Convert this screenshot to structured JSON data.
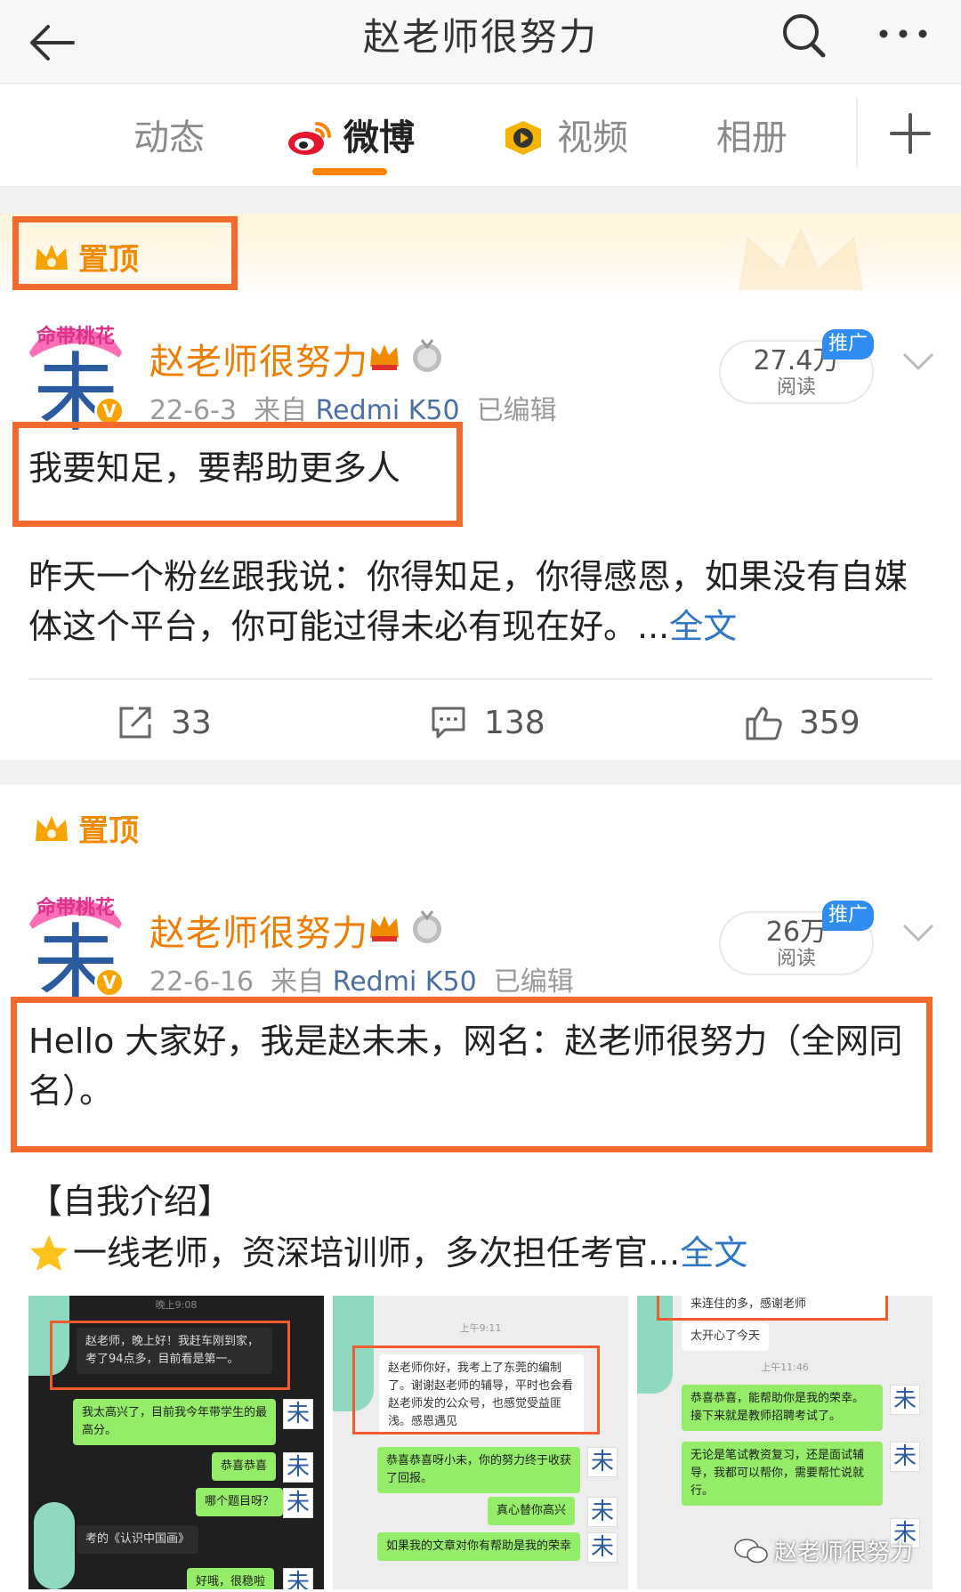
{
  "header": {
    "title": "赵老师很努力",
    "back_icon": "back-arrow-icon",
    "search_icon": "search-icon",
    "more_icon": "more-dots-icon"
  },
  "tabs": [
    {
      "label": "动态",
      "active": false
    },
    {
      "label": "微博",
      "active": true,
      "icon": "weibo-logo-icon"
    },
    {
      "label": "视频",
      "active": false,
      "icon": "video-play-icon"
    },
    {
      "label": "相册",
      "active": false
    }
  ],
  "tab_add_icon": "plus-icon",
  "colors": {
    "accent": "#ff8200",
    "highlight_box": "#f46a2d",
    "username": "#f07c00",
    "link": "#2f76c5",
    "promo": "#2f8cf0"
  },
  "posts": [
    {
      "pinned_label": "置顶",
      "username": "赵老师很努力",
      "avatar_char": "未",
      "avatar_banner": "命带桃花",
      "date": "22-6-3",
      "source_prefix": "来自",
      "source": "Redmi K50",
      "edited": "已编辑",
      "reads": "27.4万",
      "reads_label": "阅读",
      "promo": "推广",
      "headline": "我要知足，要帮助更多人",
      "body": "昨天一个粉丝跟我说：你得知足，你得感恩，如果没有自媒体这个平台，你可能过得未必有现在好。...",
      "more_label": "全文",
      "repost_count": "33",
      "comment_count": "138",
      "like_count": "359"
    },
    {
      "pinned_label": "置顶",
      "username": "赵老师很努力",
      "avatar_char": "未",
      "avatar_banner": "命带桃花",
      "date": "22-6-16",
      "source_prefix": "来自",
      "source": "Redmi K50",
      "edited": "已编辑",
      "reads": "26万",
      "reads_label": "阅读",
      "promo": "推广",
      "headline": "Hello 大家好，我是赵未未，网名：赵老师很努力（全网同名）。",
      "intro_title": "【自我介绍】",
      "intro_line": "一线老师，资深培训师，多次担任考官...",
      "more_label": "全文"
    }
  ],
  "images": [
    {
      "time": "晚上9:08",
      "messages": [
        "赵老师，晚上好！我赶车刚到家，考了94点多，目前看是第一。",
        "我太高兴了，目前我今年带学生的最高分。",
        "恭喜恭喜",
        "哪个题目呀？",
        "考的《认识中国画》",
        "好哦，很稳啦"
      ]
    },
    {
      "time": "上午9:11",
      "messages": [
        "赵老师你好，我考上了东莞的编制了。谢谢赵老师的辅导，平时也会看赵老师发的公众号，也感觉受益匪浅。感恩遇见",
        "恭喜恭喜呀小未，你的努力终于收获了回报。",
        "真心替你高兴",
        "如果我的文章对你有帮助是我的荣幸"
      ]
    },
    {
      "time": "上午11:46",
      "messages": [
        "来连住的多，感谢老师",
        "太开心了今天",
        "恭喜恭喜，能帮助你是我的荣幸。接下来就是教师招聘考试了。",
        "无论是笔试教资复习，还是面试辅导，我都可以帮你，需要帮忙说就行。"
      ],
      "watermark": "赵老师很努力"
    }
  ]
}
